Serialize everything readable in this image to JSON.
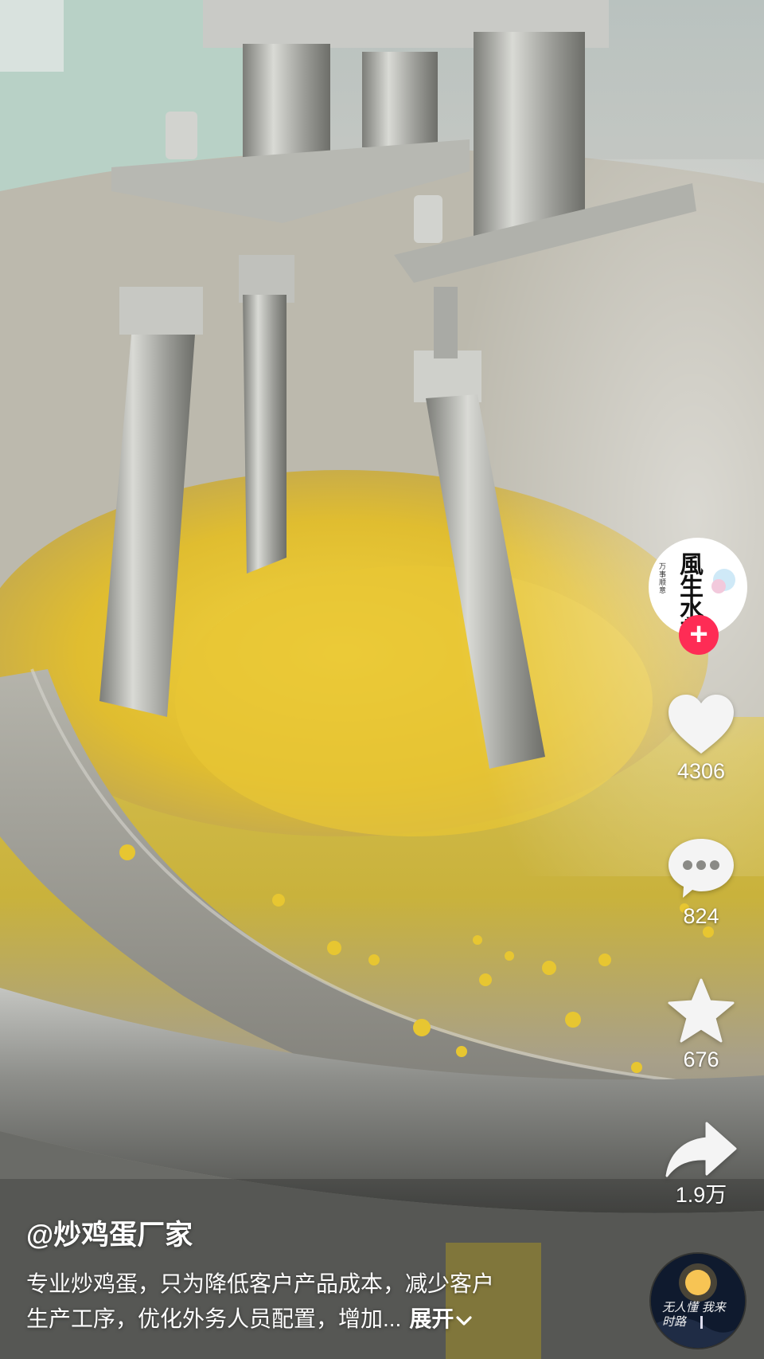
{
  "author": {
    "handle": "@炒鸡蛋厂家",
    "avatar_text_main": "風生水起",
    "avatar_text_side": "万事顺意",
    "follow_symbol": "+"
  },
  "actions": {
    "like_count": "4306",
    "comment_count": "824",
    "favorite_count": "676",
    "share_count": "1.9万"
  },
  "caption": {
    "line1": "专业炒鸡蛋，只为降低客户产品成本，减少客户",
    "line2": "生产工序，优化外务人员配置，增加...",
    "expand_label": "展开"
  },
  "music": {
    "disc_text": "无人懂 我来时路"
  },
  "colors": {
    "follow_red": "#fe2c55",
    "egg_yellow": "#e2c23a",
    "steel": "#a9a9a4"
  }
}
